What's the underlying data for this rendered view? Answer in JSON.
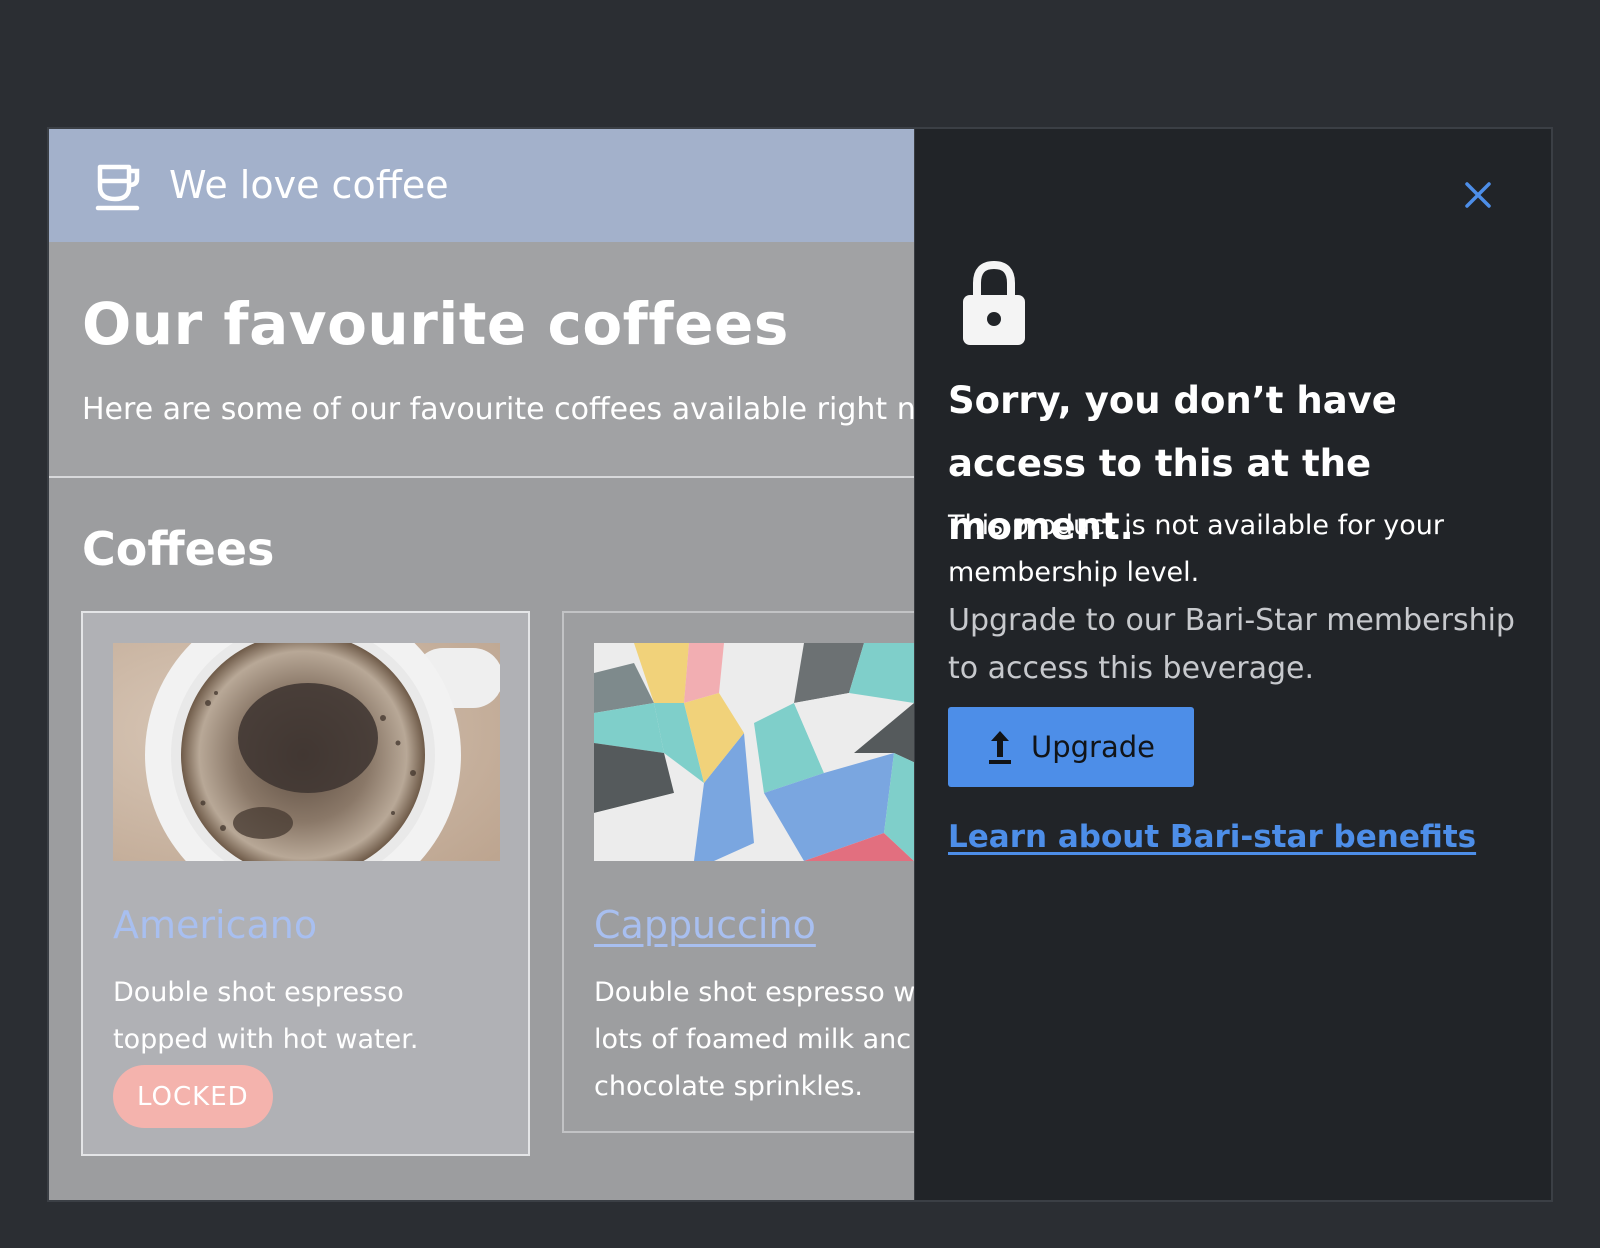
{
  "header": {
    "brand_icon": "coffee-cup-icon",
    "brand_title": "We love coffee"
  },
  "hero": {
    "title": "Our favourite coffees",
    "subtitle": "Here are some of our favourite coffees available right n"
  },
  "section": {
    "title": "Coffees"
  },
  "cards": [
    {
      "name": "Americano",
      "desc_line1": "Double shot espresso",
      "desc_line2": "topped with hot water.",
      "badge": "LOCKED"
    },
    {
      "name": "Cappuccino",
      "desc_line1": "Double shot espresso w",
      "desc_line2": "lots of foamed milk anc",
      "desc_line3": "chocolate sprinkles."
    }
  ],
  "dialog": {
    "close_icon": "close-icon",
    "lock_icon": "lock-icon",
    "title": "Sorry, you don’t have access to this at the moment.",
    "message": "This product is not available for your membership level.",
    "upsell": "Upgrade to our Bari-Star membership to access this beverage.",
    "upgrade_label": "Upgrade",
    "upgrade_icon": "upload-arrow-icon",
    "learn_link": "Learn about Bari-star benefits"
  },
  "colors": {
    "accent": "#4d8ee8",
    "panel_bg": "#212428",
    "locked_badge": "#f4b3ad",
    "card_link": "#a8bff0"
  }
}
